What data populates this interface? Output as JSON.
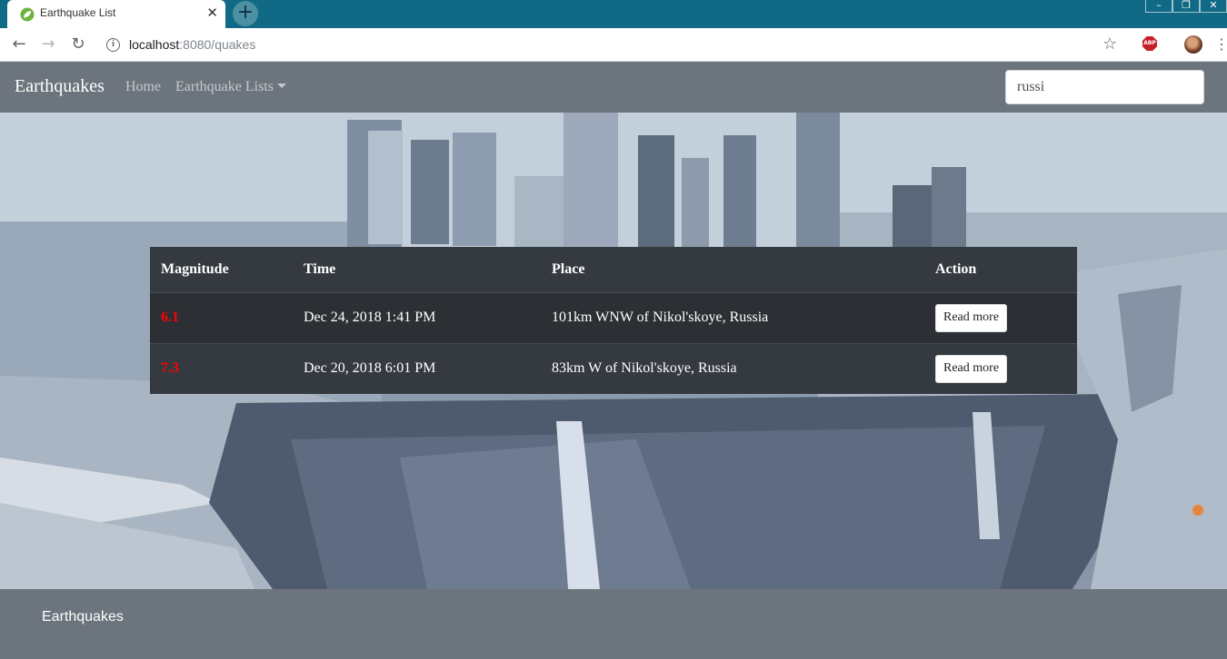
{
  "browser": {
    "tab_title": "Earthquake List",
    "url_host": "localhost",
    "url_path": ":8080/quakes",
    "window_controls": [
      "minimize",
      "restore",
      "close"
    ]
  },
  "navbar": {
    "brand": "Earthquakes",
    "links": [
      "Home",
      "Earthquake Lists"
    ],
    "search_value": "russi"
  },
  "table": {
    "headers": [
      "Magnitude",
      "Time",
      "Place",
      "Action"
    ],
    "rows": [
      {
        "magnitude": "6.1",
        "time": "Dec 24, 2018 1:41 PM",
        "place": "101km WNW of Nikol'skoye, Russia",
        "action": "Read more"
      },
      {
        "magnitude": "7.3",
        "time": "Dec 20, 2018 6:01 PM",
        "place": "83km W of Nikol'skoye, Russia",
        "action": "Read more"
      }
    ]
  },
  "footer": {
    "text": "Earthquakes"
  },
  "colors": {
    "navbar": "#6c757d",
    "table": "#343a40",
    "magnitude": "#ff0000",
    "tabstrip": "#106a85"
  }
}
